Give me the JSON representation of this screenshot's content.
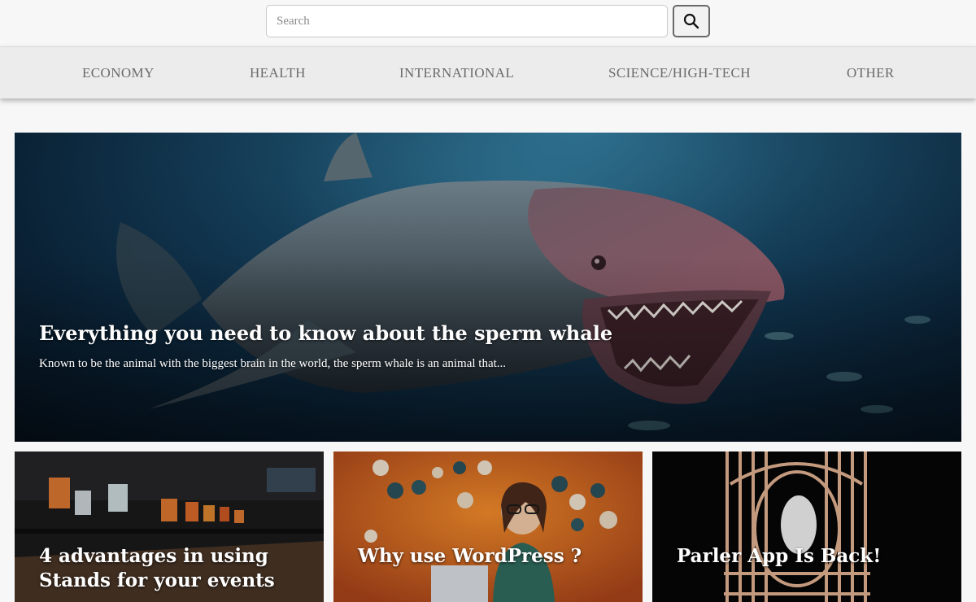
{
  "search": {
    "placeholder": "Search",
    "value": ""
  },
  "nav": [
    {
      "label": "ECONOMY"
    },
    {
      "label": "HEALTH"
    },
    {
      "label": "INTERNATIONAL"
    },
    {
      "label": "SCIENCE/HIGH-TECH"
    },
    {
      "label": "OTHER"
    }
  ],
  "featured": {
    "title": "Everything you need to know about the sperm whale",
    "excerpt": "Known to be the animal with the biggest brain in the world, the sperm whale is an animal that..."
  },
  "cards": [
    {
      "title": "4 advantages in using Stands for your events"
    },
    {
      "title": "Why use WordPress ?"
    },
    {
      "title": "Parler App Is Back!"
    }
  ],
  "icons": {
    "search": "search-icon"
  }
}
